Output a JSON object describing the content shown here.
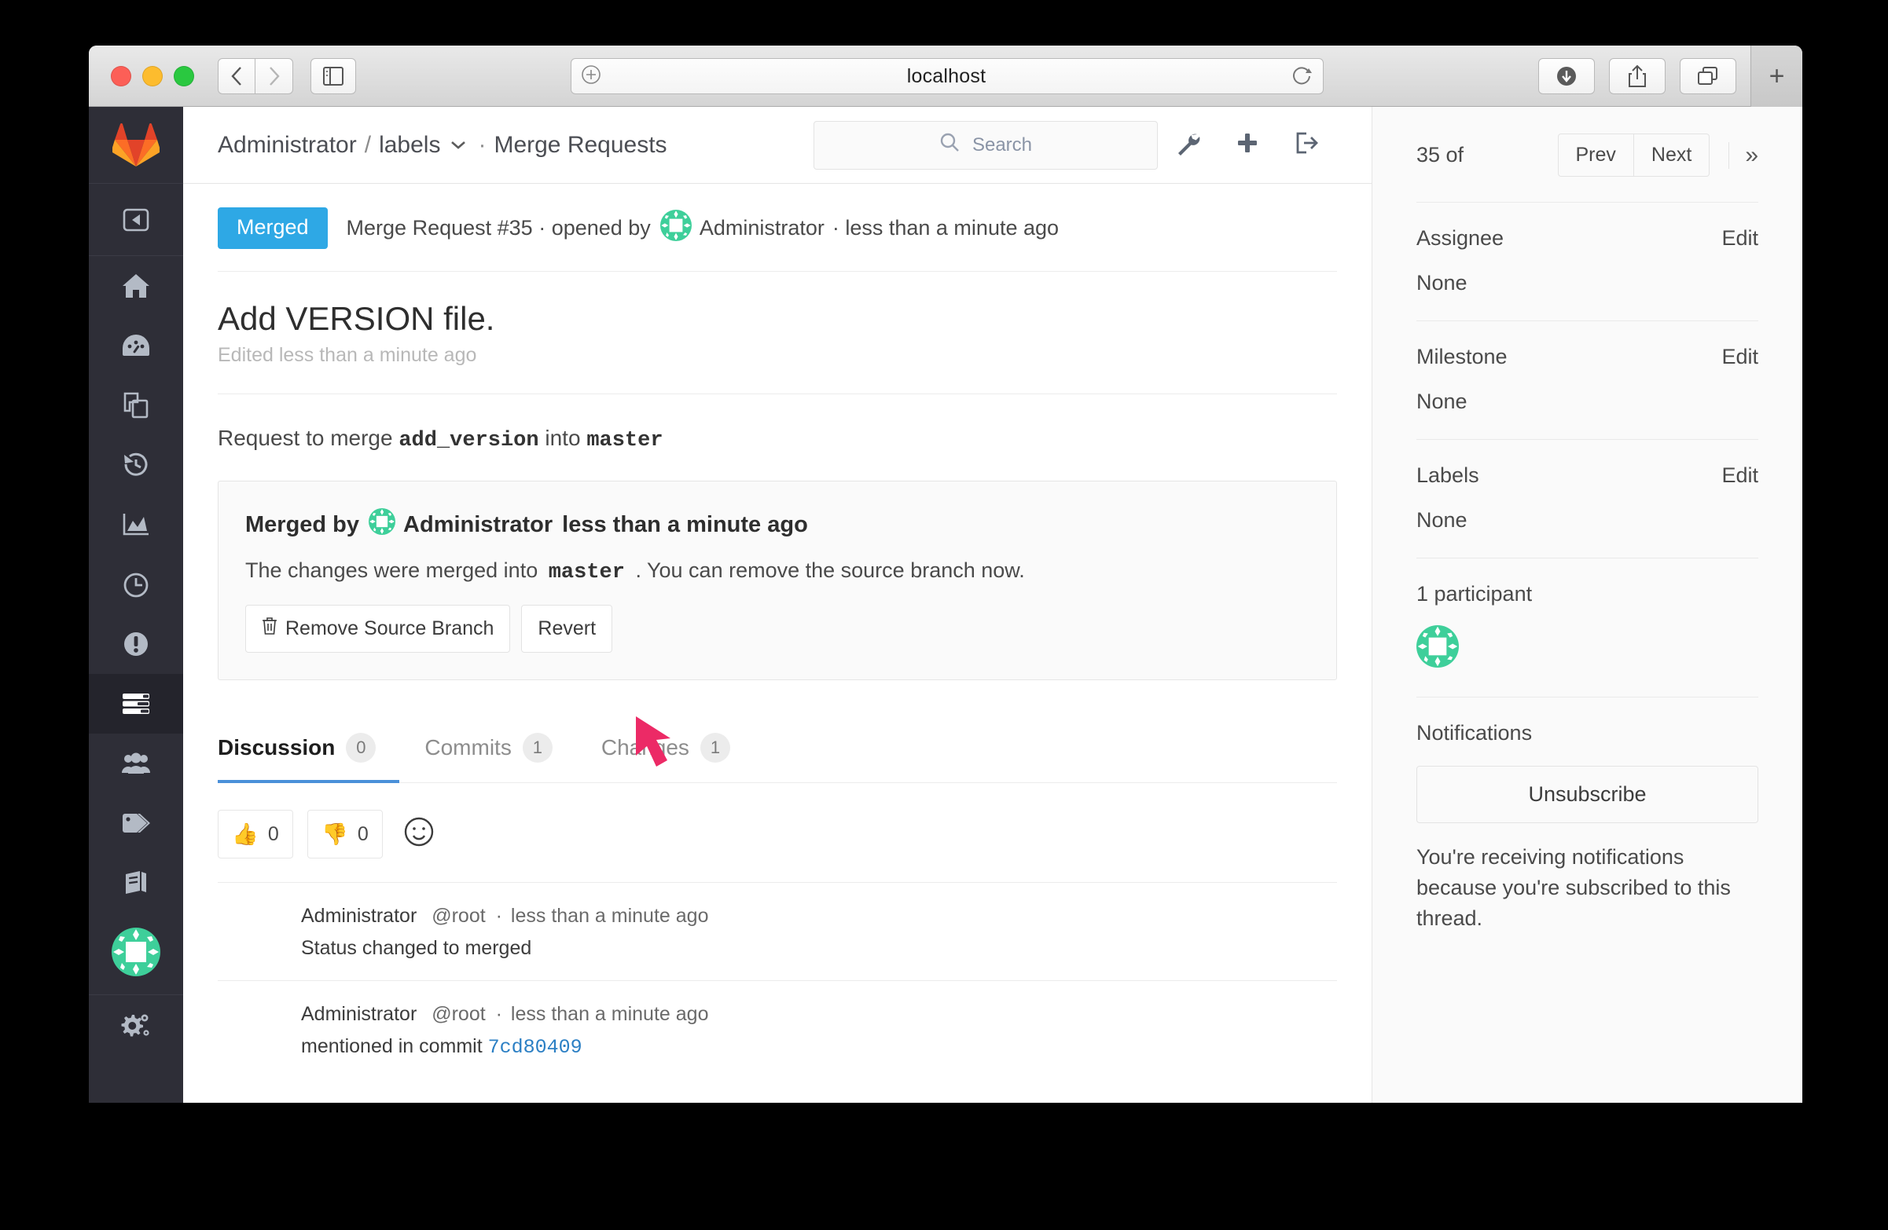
{
  "browser": {
    "url": "localhost",
    "icons": {
      "back": "back-arrow-icon",
      "forward": "forward-arrow-icon",
      "sidebar": "sidebar-toggle-icon",
      "reader": "reader-plus-icon",
      "reload": "reload-icon",
      "downloads": "downloads-icon",
      "share": "share-icon",
      "tabs": "tab-overview-icon",
      "new_tab": "+"
    }
  },
  "rail": {
    "logo": "gitlab-logo",
    "items": [
      {
        "name": "collapse-sidebar",
        "icon": "collapse-panel-icon",
        "active": false
      },
      {
        "name": "project-home",
        "icon": "home-icon",
        "active": false
      },
      {
        "name": "activity",
        "icon": "dashboard-icon",
        "active": false
      },
      {
        "name": "repository",
        "icon": "files-icon",
        "active": false
      },
      {
        "name": "commits",
        "icon": "history-icon",
        "active": false
      },
      {
        "name": "graphs",
        "icon": "chart-icon",
        "active": false
      },
      {
        "name": "milestones",
        "icon": "clock-icon",
        "active": false
      },
      {
        "name": "issues",
        "icon": "issues-icon",
        "active": false
      },
      {
        "name": "merge-requests",
        "icon": "merge-requests-icon",
        "active": true
      },
      {
        "name": "members",
        "icon": "people-icon",
        "active": false
      },
      {
        "name": "labels",
        "icon": "tag-icon",
        "active": false
      },
      {
        "name": "wiki",
        "icon": "book-icon",
        "active": false
      }
    ],
    "avatar": "user-avatar-identicon",
    "settings": "gears-icon"
  },
  "topnav": {
    "namespace": "Administrator",
    "slash": "/",
    "project": "labels",
    "dot": "·",
    "section": "Merge Requests",
    "search_placeholder": "Search",
    "icons": {
      "search": "search-icon",
      "wrench": "wrench-icon",
      "plus": "plus-icon",
      "signout": "sign-out-icon"
    }
  },
  "mr": {
    "state_badge": "Merged",
    "meta_prefix": "Merge Request #35 · opened by",
    "author": "Administrator",
    "meta_suffix": "· less than a minute ago",
    "title": "Add VERSION file.",
    "edited": "Edited less than a minute ago",
    "merge_line": {
      "prefix": "Request to merge",
      "source": "add_version",
      "mid": "into",
      "target": "master"
    },
    "widget": {
      "merged_by_prefix": "Merged by",
      "merged_by_user": "Administrator",
      "merged_by_time": "less than a minute ago",
      "text_prefix": "The changes were merged into",
      "text_branch": "master",
      "text_suffix": ". You can remove the source branch now.",
      "remove_branch_label": "Remove Source Branch",
      "remove_branch_icon": "trash-icon",
      "revert_label": "Revert"
    },
    "tabs": [
      {
        "label": "Discussion",
        "count": "0",
        "active": true
      },
      {
        "label": "Commits",
        "count": "1",
        "active": false
      },
      {
        "label": "Changes",
        "count": "1",
        "active": false
      }
    ],
    "awards": {
      "thumbsup": {
        "emoji": "👍",
        "count": "0",
        "name": "thumbsup-award"
      },
      "thumbsdown": {
        "emoji": "👎",
        "count": "0",
        "name": "thumbsdown-award"
      },
      "add": "☺"
    },
    "notes": [
      {
        "user": "Administrator",
        "handle": "@root",
        "sep": "·",
        "time": "less than a minute ago",
        "body_prefix": "Status changed to merged",
        "body_link": "",
        "body_suffix": ""
      },
      {
        "user": "Administrator",
        "handle": "@root",
        "sep": "·",
        "time": "less than a minute ago",
        "body_prefix": "mentioned in commit ",
        "body_link": "7cd80409",
        "body_suffix": ""
      }
    ]
  },
  "sidebar": {
    "counter": "35 of",
    "prev": "Prev",
    "next": "Next",
    "collapse_icon": "»",
    "assignee": {
      "label": "Assignee",
      "edit": "Edit",
      "value": "None"
    },
    "milestone": {
      "label": "Milestone",
      "edit": "Edit",
      "value": "None"
    },
    "labels": {
      "label": "Labels",
      "edit": "Edit",
      "value": "None"
    },
    "participants": {
      "label": "1 participant"
    },
    "notifications": {
      "label": "Notifications",
      "button": "Unsubscribe",
      "text": "You're receiving notifications because you're subscribed to this thread."
    }
  },
  "colors": {
    "badge_blue": "#2ea8e5",
    "tab_underline": "#4a90d9",
    "link_blue": "#2b7fc4",
    "rail_bg": "#2e2e37",
    "cursor_pink": "#ec2a66",
    "identicon_green": "#3ecf9a"
  }
}
